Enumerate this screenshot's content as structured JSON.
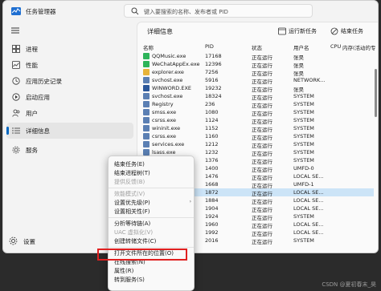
{
  "window": {
    "title": "任务管理器"
  },
  "search": {
    "placeholder": "键入要搜索的名称、发布者或 PID"
  },
  "nav": {
    "items": [
      {
        "label": "进程"
      },
      {
        "label": "性能"
      },
      {
        "label": "应用历史记录"
      },
      {
        "label": "启动应用"
      },
      {
        "label": "用户"
      },
      {
        "label": "详细信息"
      },
      {
        "label": "服务"
      }
    ],
    "settings_label": "设置"
  },
  "page": {
    "title": "详细信息"
  },
  "toolbar": {
    "run_new_task": "运行新任务",
    "end_task": "结束任务"
  },
  "table": {
    "headers": {
      "name": "名称",
      "pid": "PID",
      "status": "状态",
      "user": "用户名",
      "cpu": "CPU",
      "memory": "内存(活动的专"
    },
    "rows": [
      {
        "name": "QQMusic.exe",
        "pid": "17168",
        "status": "正在运行",
        "user": "张昊",
        "icon_color": "#2db45a"
      },
      {
        "name": "WeChatAppEx.exe",
        "pid": "12396",
        "status": "正在运行",
        "user": "张昊",
        "icon_color": "#2db45a"
      },
      {
        "name": "explorer.exe",
        "pid": "7256",
        "status": "正在运行",
        "user": "张昊",
        "icon_color": "#e8b43a"
      },
      {
        "name": "svchost.exe",
        "pid": "5916",
        "status": "正在运行",
        "user": "NETWORK...",
        "icon_color": "#5b7fb3"
      },
      {
        "name": "WINWORD.EXE",
        "pid": "19232",
        "status": "正在运行",
        "user": "张昊",
        "icon_color": "#2b579a"
      },
      {
        "name": "svchost.exe",
        "pid": "18324",
        "status": "正在运行",
        "user": "SYSTEM",
        "icon_color": "#5b7fb3"
      },
      {
        "name": "Registry",
        "pid": "236",
        "status": "正在运行",
        "user": "SYSTEM",
        "icon_color": "#5b7fb3"
      },
      {
        "name": "smss.exe",
        "pid": "1080",
        "status": "正在运行",
        "user": "SYSTEM",
        "icon_color": "#5b7fb3"
      },
      {
        "name": "csrss.exe",
        "pid": "1124",
        "status": "正在运行",
        "user": "SYSTEM",
        "icon_color": "#5b7fb3"
      },
      {
        "name": "wininit.exe",
        "pid": "1152",
        "status": "正在运行",
        "user": "SYSTEM",
        "icon_color": "#5b7fb3"
      },
      {
        "name": "csrss.exe",
        "pid": "1160",
        "status": "正在运行",
        "user": "SYSTEM",
        "icon_color": "#5b7fb3"
      },
      {
        "name": "services.exe",
        "pid": "1212",
        "status": "正在运行",
        "user": "SYSTEM",
        "icon_color": "#5b7fb3"
      },
      {
        "name": "lsass.exe",
        "pid": "1232",
        "status": "正在运行",
        "user": "SYSTEM",
        "icon_color": "#5b7fb3"
      },
      {
        "name": "svchost.exe",
        "pid": "1376",
        "status": "正在运行",
        "user": "SYSTEM",
        "icon_color": "#5b7fb3"
      },
      {
        "name": "fontdrvhost.exe",
        "pid": "1400",
        "status": "正在运行",
        "user": "UMFD-0",
        "icon_color": "#5b7fb3"
      },
      {
        "name": "",
        "pid": "1476",
        "status": "正在运行",
        "user": "LOCAL SE...",
        "icon_color": ""
      },
      {
        "name": "",
        "pid": "1668",
        "status": "正在运行",
        "user": "UMFD-1",
        "icon_color": ""
      },
      {
        "name": "",
        "pid": "1872",
        "status": "正在运行",
        "user": "LOCAL SE...",
        "icon_color": "",
        "selected": true
      },
      {
        "name": "",
        "pid": "1884",
        "status": "正在运行",
        "user": "LOCAL SE...",
        "icon_color": ""
      },
      {
        "name": "",
        "pid": "1904",
        "status": "正在运行",
        "user": "LOCAL SE...",
        "icon_color": ""
      },
      {
        "name": "",
        "pid": "1924",
        "status": "正在运行",
        "user": "SYSTEM",
        "icon_color": ""
      },
      {
        "name": "",
        "pid": "1960",
        "status": "正在运行",
        "user": "LOCAL SE...",
        "icon_color": ""
      },
      {
        "name": "",
        "pid": "1992",
        "status": "正在运行",
        "user": "LOCAL SE...",
        "icon_color": ""
      },
      {
        "name": "",
        "pid": "2016",
        "status": "正在运行",
        "user": "SYSTEM",
        "icon_color": ""
      }
    ]
  },
  "context_menu": {
    "items": [
      {
        "label": "结束任务(E)",
        "disabled": false,
        "submenu": false
      },
      {
        "label": "结束进程树(T)",
        "disabled": false,
        "submenu": false
      },
      {
        "label": "提供反馈(B)",
        "disabled": true,
        "submenu": false
      },
      {
        "label": "效能模式(V)",
        "disabled": true,
        "submenu": false
      },
      {
        "label": "设置优先级(P)",
        "disabled": false,
        "submenu": true
      },
      {
        "label": "设置相关性(F)",
        "disabled": false,
        "submenu": false
      },
      {
        "label": "分析等待链(A)",
        "disabled": false,
        "submenu": false
      },
      {
        "label": "UAC 虚拟化(V)",
        "disabled": true,
        "submenu": false
      },
      {
        "label": "创建转储文件(C)",
        "disabled": false,
        "submenu": false
      },
      {
        "label": "打开文件所在的位置(O)",
        "disabled": false,
        "submenu": false
      },
      {
        "label": "在线搜索(N)",
        "disabled": false,
        "submenu": false
      },
      {
        "label": "属性(R)",
        "disabled": false,
        "submenu": false
      },
      {
        "label": "转到服务(S)",
        "disabled": false,
        "submenu": false
      }
    ]
  },
  "watermark": "CSDN @夏初春末_昊"
}
